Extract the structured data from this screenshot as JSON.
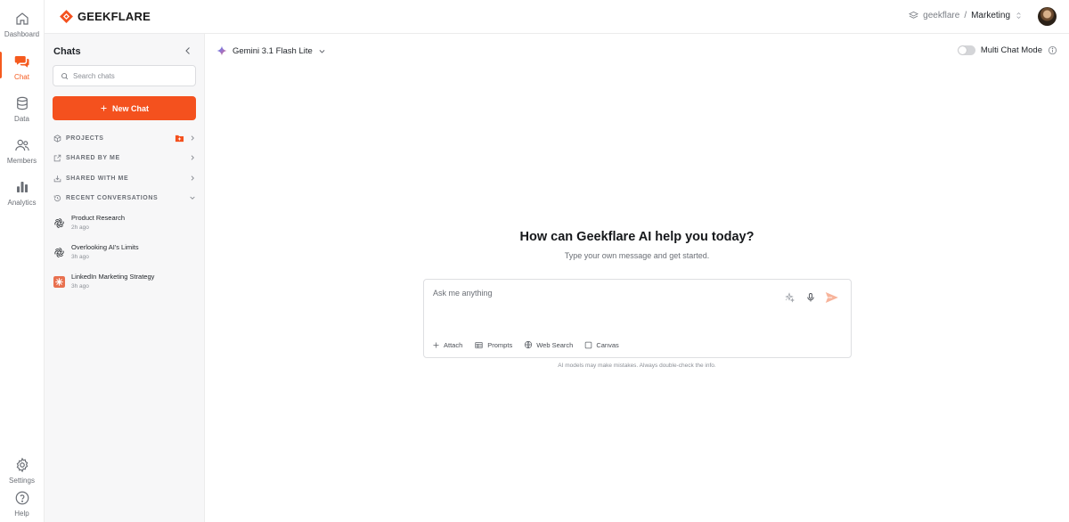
{
  "brand": {
    "name": "GEEKFLARE",
    "accent": "#f4511e"
  },
  "rail": {
    "items": [
      {
        "label": "Dashboard",
        "icon": "home-icon"
      },
      {
        "label": "Chat",
        "icon": "chat-bubbles-icon",
        "active": true
      },
      {
        "label": "Data",
        "icon": "database-icon"
      },
      {
        "label": "Members",
        "icon": "users-icon"
      },
      {
        "label": "Analytics",
        "icon": "bar-chart-icon"
      }
    ],
    "bottom": [
      {
        "label": "Settings",
        "icon": "gear-icon"
      },
      {
        "label": "Help",
        "icon": "help-circle-icon"
      }
    ]
  },
  "header": {
    "workspace": "geekflare",
    "separator": "/",
    "team": "Marketing"
  },
  "sidebar": {
    "title": "Chats",
    "search_placeholder": "Search chats",
    "new_chat_label": "New Chat",
    "sections": [
      {
        "label": "PROJECTS",
        "icon": "cube-icon"
      },
      {
        "label": "SHARED BY ME",
        "icon": "share-out-icon"
      },
      {
        "label": "SHARED WITH ME",
        "icon": "inbox-icon"
      },
      {
        "label": "RECENT CONVERSATIONS",
        "icon": "history-icon"
      }
    ],
    "conversations": [
      {
        "title": "Product Research",
        "time": "2h ago",
        "icon": "openai-icon"
      },
      {
        "title": "Overlooking AI's Limits",
        "time": "3h ago",
        "icon": "openai-icon"
      },
      {
        "title": "LinkedIn Marketing Strategy",
        "time": "3h ago",
        "icon": "claude-icon"
      }
    ]
  },
  "main": {
    "model": "Gemini 3.1 Flash Lite",
    "multi_chat_label": "Multi Chat Mode",
    "hero_title": "How can Geekflare AI help you today?",
    "hero_subtitle": "Type your own message and get started.",
    "composer_placeholder": "Ask me anything",
    "tools": [
      {
        "label": "Attach",
        "icon": "plus-icon"
      },
      {
        "label": "Prompts",
        "icon": "prompts-icon"
      },
      {
        "label": "Web Search",
        "icon": "globe-icon"
      },
      {
        "label": "Canvas",
        "icon": "canvas-icon"
      }
    ],
    "disclaimer": "AI models may make mistakes. Always double-check the info."
  }
}
